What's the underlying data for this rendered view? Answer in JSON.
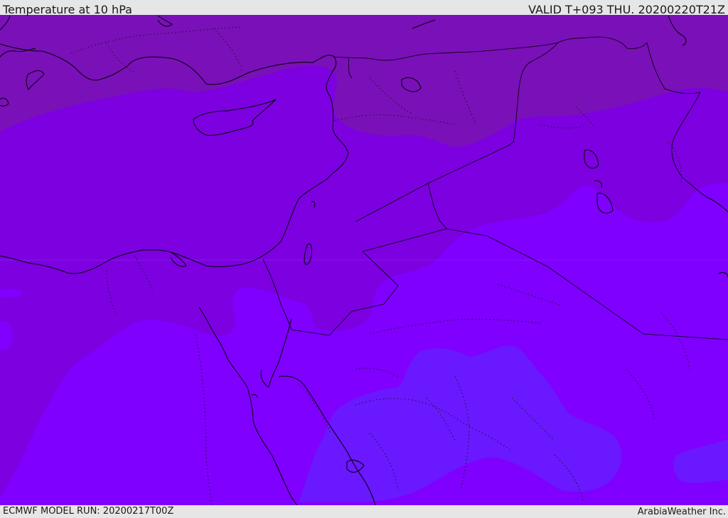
{
  "header": {
    "title": "Temperature at 10 hPa",
    "valid_time": "VALID T+093 THU. 20200220T21Z"
  },
  "footer": {
    "model_run": "ECMWF MODEL RUN: 20200217T00Z",
    "brand": "ArabiaWeather Inc."
  },
  "colors": {
    "band_warm": "#7a10b8",
    "band_mid": "#7c00e0",
    "band_cool": "#7f00ff",
    "band_coldest": "#6a18ff",
    "coastline": "#000000"
  }
}
